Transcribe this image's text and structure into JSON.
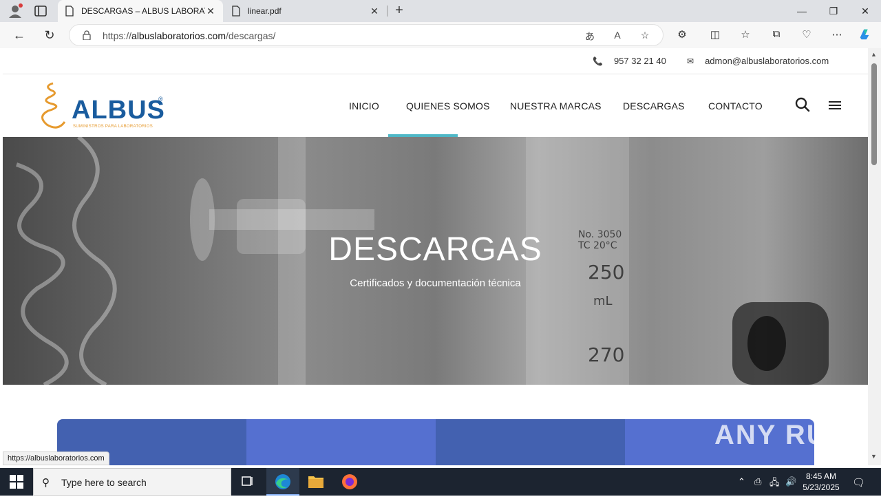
{
  "browser": {
    "tabs": [
      {
        "title": "DESCARGAS – ALBUS LABORATORIOS",
        "active": true
      },
      {
        "title": "linear.pdf",
        "active": false
      }
    ],
    "address": {
      "scheme": "https://",
      "host": "albuslaboratorios.com",
      "path": "/descargas/"
    },
    "status_url": "https://albuslaboratorios.com"
  },
  "site": {
    "topbar": {
      "phone": "957 32 21 40",
      "email": "admon@albuslaboratorios.com"
    },
    "logo": {
      "brand": "ALBUS",
      "tagline": "SUMINISTROS PARA LABORATORIOS",
      "reg": "®"
    },
    "nav": [
      "INICIO",
      "QUIENES SOMOS",
      "NUESTRA MARCAS",
      "DESCARGAS",
      "CONTACTO"
    ],
    "hero": {
      "title": "DESCARGAS",
      "subtitle": "Certificados y documentación técnica"
    },
    "card_colors": [
      "#4361b0",
      "#5570d0",
      "#4361b0",
      "#5570d0"
    ],
    "accent": "#4fb8c7"
  },
  "watermark": "ANY RUN",
  "taskbar": {
    "search_placeholder": "Type here to search",
    "time": "8:45 AM",
    "date": "5/23/2025"
  }
}
